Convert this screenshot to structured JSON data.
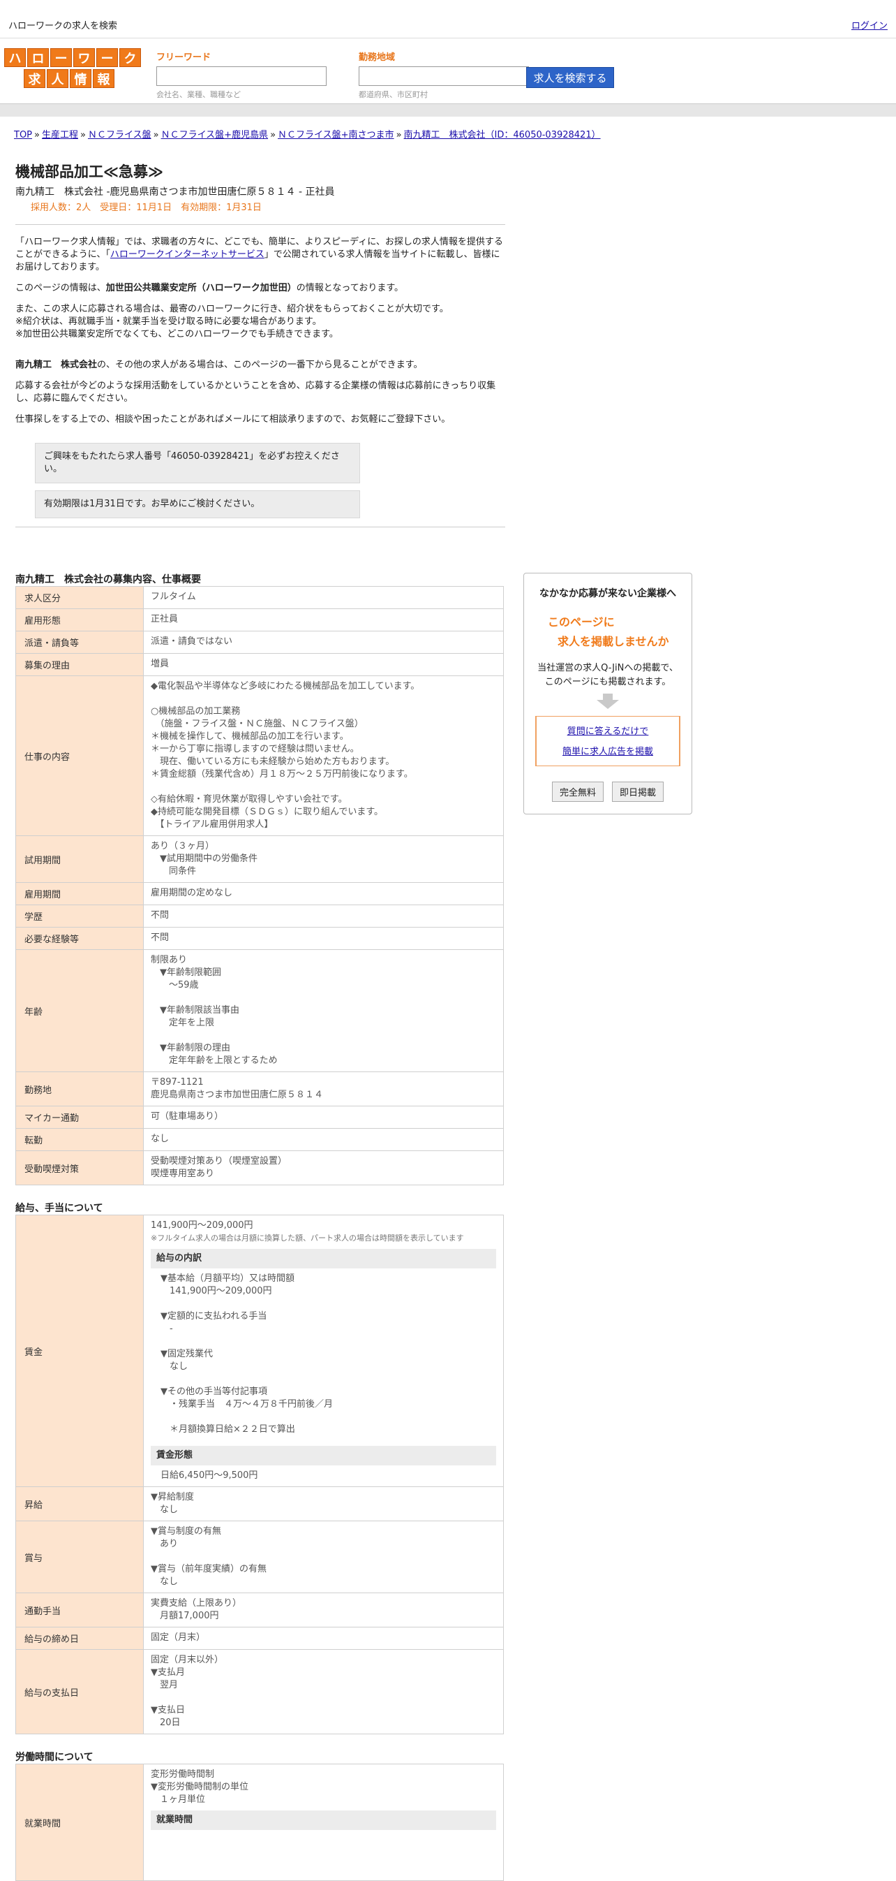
{
  "topbar": {
    "site_title": "ハローワークの求人を検索",
    "login": "ログイン"
  },
  "logo": {
    "row1": [
      "ハ",
      "ロ",
      "ー",
      "ワ",
      "ー",
      "ク"
    ],
    "row2": [
      "求",
      "人",
      "情",
      "報"
    ]
  },
  "search": {
    "keyword_label": "フリーワード",
    "keyword_placeholder": "会社名、業種、職種など",
    "area_label": "勤務地域",
    "area_placeholder": "都道府県、市区町村",
    "button": "求人を検索する"
  },
  "breadcrumb": {
    "items": [
      "TOP",
      "生産工程",
      "ＮＣフライス盤",
      "ＮＣフライス盤+鹿児島県",
      "ＮＣフライス盤+南さつま市",
      "南九精工　株式会社（ID：46050-03928421）"
    ],
    "sep": "»"
  },
  "job": {
    "title": "機械部品加工≪急募≫",
    "subtitle": "南九精工　株式会社 -鹿児島県南さつま市加世田唐仁原５８１４ - 正社員",
    "meta": "採用人数：2人　受理日：11月1日　有効期限：1月31日"
  },
  "intro": {
    "p1a": "「ハローワーク求人情報」では、求職者の方々に、どこでも、簡単に、よりスピーディに、お探しの求人情報を提供することができるように、「",
    "p1link": "ハローワークインターネットサービス",
    "p1b": "」で公開されている求人情報を当サイトに転載し、皆様にお届けしております。",
    "p2a": "このページの情報は、",
    "p2b": "加世田公共職業安定所（ハローワーク加世田）",
    "p2c": "の情報となっております。",
    "p3": [
      "また、この求人に応募される場合は、最寄のハローワークに行き、紹介状をもらっておくことが大切です。",
      "※紹介状は、再就職手当・就業手当を受け取る時に必要な場合があります。",
      "※加世田公共職業安定所でなくても、どこのハローワークでも手続きできます。"
    ],
    "p4a": "南九精工　株式会社",
    "p4b": "の、その他の求人がある場合は、このページの一番下から見ることができます。",
    "p5": "応募する会社が今どのような採用活動をしているかということを含め、応募する企業様の情報は応募前にきっちり収集し、応募に臨んでください。",
    "p6": "仕事探しをする上での、相談や困ったことがあればメールにて相談承りますので、お気軽にご登録下さい。",
    "notice1": "ご興味をもたれたら求人番号「46050-03928421」を必ずお控えください。",
    "notice2": "有効期限は1月31日です。お早めにご検討ください。"
  },
  "overview": {
    "heading": "南九精工　株式会社の募集内容、仕事概要",
    "rows": [
      {
        "k": "求人区分",
        "v": [
          "フルタイム"
        ]
      },
      {
        "k": "雇用形態",
        "v": [
          "正社員"
        ]
      },
      {
        "k": "派遣・請負等",
        "v": [
          "派遣・請負ではない"
        ]
      },
      {
        "k": "募集の理由",
        "v": [
          "増員"
        ]
      },
      {
        "k": "仕事の内容",
        "v": [
          "◆電化製品や半導体など多岐にわたる機械部品を加工しています。",
          "",
          "○機械部品の加工業務",
          "　（施盤・フライス盤・ＮＣ施盤、ＮＣフライス盤）",
          "＊機械を操作して、機械部品の加工を行います。",
          "＊一から丁寧に指導しますので経験は問いません。",
          "　現在、働いている方にも未経験から始めた方もおります。",
          "＊賃金総額（残業代含め）月１８万～２５万円前後になります。",
          "",
          "◇有給休暇・育児休業が取得しやすい会社です。",
          "◆持続可能な開発目標（ＳＤＧｓ）に取り組んでいます。",
          "　【トライアル雇用併用求人】"
        ]
      },
      {
        "k": "試用期間",
        "v": [
          "あり（３ヶ月）",
          "　▼試用期間中の労働条件",
          "　　同条件"
        ]
      },
      {
        "k": "雇用期間",
        "v": [
          "雇用期間の定めなし"
        ]
      },
      {
        "k": "学歴",
        "v": [
          "不問"
        ]
      },
      {
        "k": "必要な経験等",
        "v": [
          "不問"
        ]
      },
      {
        "k": "年齢",
        "v": [
          "制限あり",
          "　▼年齢制限範囲",
          "　　〜59歳",
          "",
          "　▼年齢制限該当事由",
          "　　定年を上限",
          "",
          "　▼年齢制限の理由",
          "　　定年年齢を上限とするため"
        ]
      },
      {
        "k": "勤務地",
        "v": [
          "〒897-1121",
          "鹿児島県南さつま市加世田唐仁原５８１４"
        ]
      },
      {
        "k": "マイカー通勤",
        "v": [
          "可（駐車場あり）"
        ]
      },
      {
        "k": "転勤",
        "v": [
          "なし"
        ]
      },
      {
        "k": "受動喫煙対策",
        "v": [
          "受動喫煙対策あり（喫煙室設置）",
          "喫煙専用室あり"
        ]
      }
    ]
  },
  "salary": {
    "heading": "給与、手当について",
    "wage_key": "賃金",
    "wage_range": "141,900円〜209,000円",
    "wage_note": "※フルタイム求人の場合は月額に換算した額、パート求人の場合は時間額を表示しています",
    "breakdown_title": "給与の内訳",
    "breakdown": [
      "▼基本給（月額平均）又は時間額",
      "　141,900円〜209,000円",
      "",
      "▼定額的に支払われる手当",
      "　-",
      "",
      "▼固定残業代",
      "　なし",
      "",
      "▼その他の手当等付記事項",
      "　・残業手当　４万～４万８千円前後／月",
      "",
      "　＊月額換算日給×２２日で算出"
    ],
    "form_title": "賃金形態",
    "form_value": "日給6,450円〜9,500円",
    "rows": [
      {
        "k": "昇給",
        "v": [
          "▼昇給制度",
          "　なし"
        ]
      },
      {
        "k": "賞与",
        "v": [
          "▼賞与制度の有無",
          "　あり",
          "",
          "▼賞与（前年度実績）の有無",
          "　なし"
        ]
      },
      {
        "k": "通勤手当",
        "v": [
          "実費支給（上限あり）",
          "　月額17,000円"
        ]
      },
      {
        "k": "給与の締め日",
        "v": [
          "固定（月末）"
        ]
      },
      {
        "k": "給与の支払日",
        "v": [
          "固定（月末以外）",
          "▼支払月",
          "　翌月",
          "",
          "▼支払日",
          "　20日"
        ]
      }
    ]
  },
  "worktime": {
    "heading": "労働時間について",
    "key": "就業時間",
    "v": [
      "変形労働時間制",
      "▼変形労働時間制の単位",
      "　１ヶ月単位"
    ],
    "sub": "就業時間"
  },
  "ad": {
    "heading": "なかなか応募が来ない企業様へ",
    "orange1": "このページに",
    "orange2": "求人を掲載しませんか",
    "text1": "当社運営の求人Q-JiNへの掲載で、",
    "text2": "このページにも掲載されます。",
    "link1": "質問に答えるだけで",
    "link2": "簡単に求人広告を掲載",
    "btn1": "完全無料",
    "btn2": "即日掲載"
  }
}
